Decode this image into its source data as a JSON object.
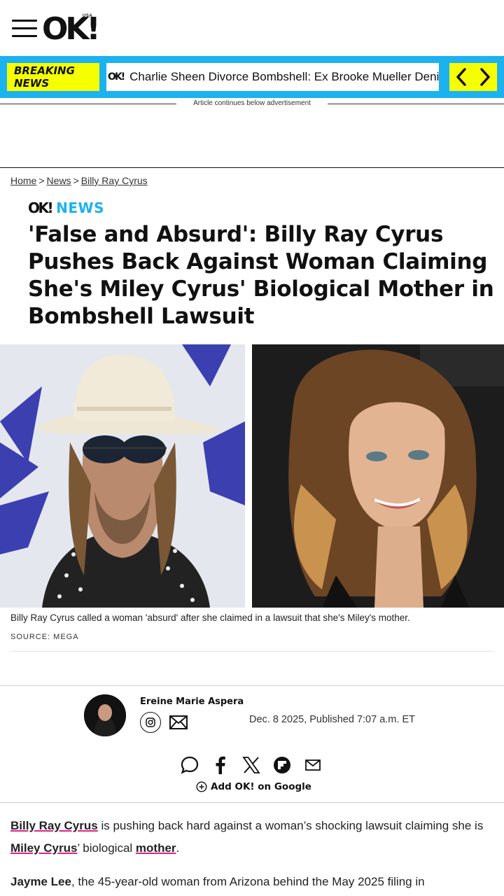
{
  "header": {
    "logo_text": "OK!",
    "logo_sub": "USA"
  },
  "breaking": {
    "badge_line1": "BREAKING",
    "badge_line2": "NEWS",
    "ticker_logo": "OK!",
    "ticker_text": "Charlie Sheen Divorce Bombshell: Ex Brooke Mueller Denies"
  },
  "ad": {
    "notice": "Article continues below advertisement"
  },
  "breadcrumb": {
    "items": [
      "Home",
      "News",
      "Billy Ray Cyrus"
    ],
    "separator": ">"
  },
  "section": {
    "brand": "OK!",
    "label": "NEWS"
  },
  "article": {
    "title": "'False and Absurd': Billy Ray Cyrus Pushes Back Against Woman Claiming She's Miley Cyrus' Biological Mother in Bombshell Lawsuit",
    "caption": "Billy Ray Cyrus called a woman 'absurd' after she claimed in a lawsuit that she's Miley's mother.",
    "source": "SOURCE: MEGA"
  },
  "author": {
    "name": "Ereine Marie Aspera",
    "date": "Dec. 8 2025, Published 7:07 a.m. ET"
  },
  "share": {
    "add_google": "Add OK! on Google"
  },
  "body": {
    "p1_link1": "Billy Ray Cyrus",
    "p1_text1": " is pushing back hard against a woman’s shocking lawsuit claiming she is ",
    "p1_link2": "Miley Cyrus",
    "p1_text2": "’ biological ",
    "p1_link3": "mother",
    "p1_text3": ".",
    "p2_bold": "Jayme Lee",
    "p2_text": ", the 45-year-old woman from Arizona behind the May 2025 filing in"
  },
  "colors": {
    "accent_blue": "#1cb2f0",
    "accent_yellow": "#f6ff00",
    "link_underline": "#e0218a"
  }
}
